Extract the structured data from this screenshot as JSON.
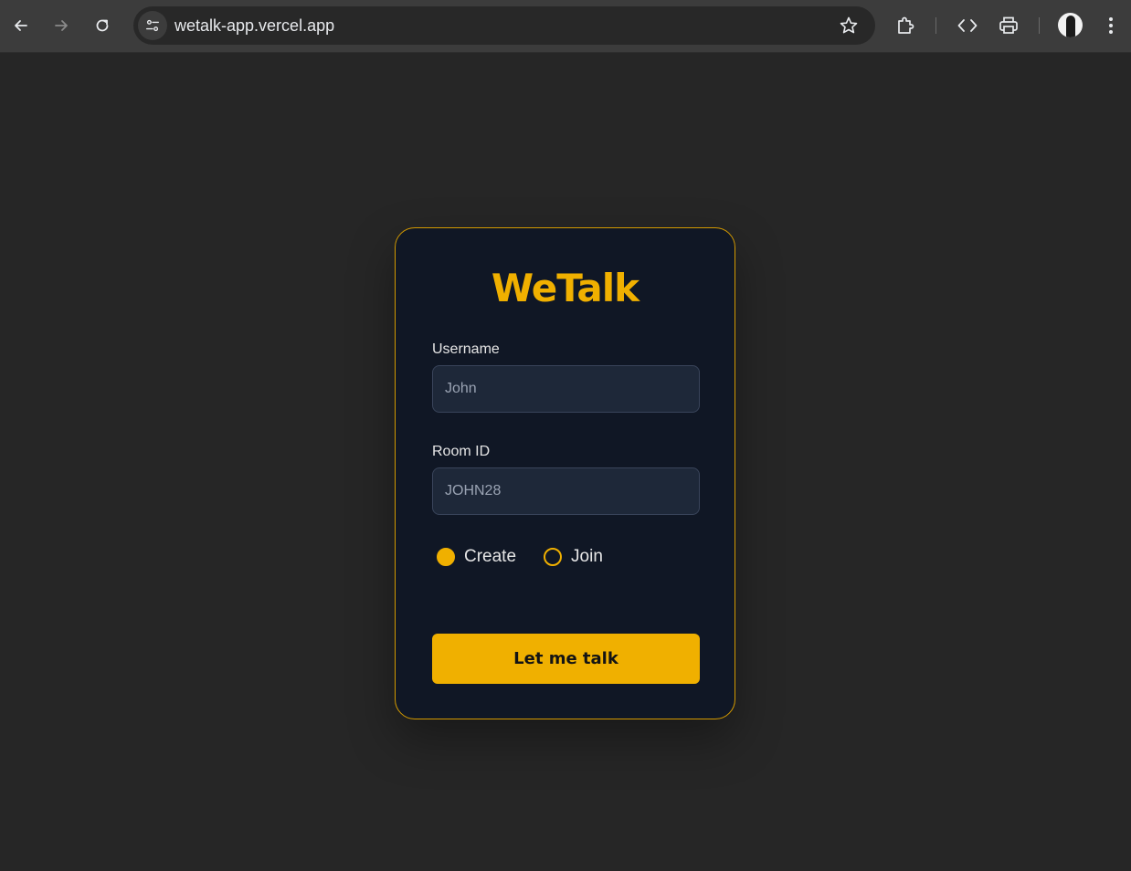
{
  "browser": {
    "url": "wetalk-app.vercel.app",
    "icons": [
      "back-icon",
      "forward-icon",
      "reload-icon",
      "site-info-icon",
      "star-icon",
      "extensions-icon",
      "code-icon",
      "print-icon",
      "avatar",
      "menu-icon"
    ]
  },
  "app": {
    "title": "WeTalk",
    "username": {
      "label": "Username",
      "placeholder": "John",
      "value": ""
    },
    "room_id": {
      "label": "Room ID",
      "placeholder": "JOHN28",
      "value": ""
    },
    "mode": {
      "options": [
        "Create",
        "Join"
      ],
      "selected": "Create"
    },
    "submit_label": "Let me talk"
  },
  "colors": {
    "accent": "#f0b000",
    "page_background": "#262626",
    "card_background": "#101725",
    "input_background": "#1e2839"
  }
}
